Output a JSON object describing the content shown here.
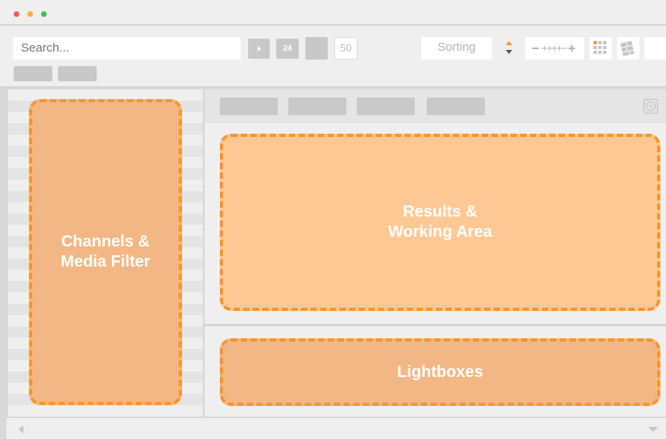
{
  "window": {
    "traffic_lights": [
      "#f05a5a",
      "#f5b23c",
      "#3cc34a"
    ]
  },
  "toolbar": {
    "search_placeholder": "Search...",
    "page_size_24": "24",
    "page_size_50": "50",
    "sorting_label": "Sorting",
    "sort_colors": {
      "up": "#f7952c",
      "down": "#555555"
    }
  },
  "zones": {
    "channels": "Channels &\nMedia Filter",
    "results": "Results &\nWorking Area",
    "lightboxes": "Lightboxes"
  },
  "colors": {
    "accent": "#f7952c",
    "channels_fill": "#f2b784",
    "results_fill": "#fec895",
    "lightboxes_fill": "#f2b784"
  }
}
